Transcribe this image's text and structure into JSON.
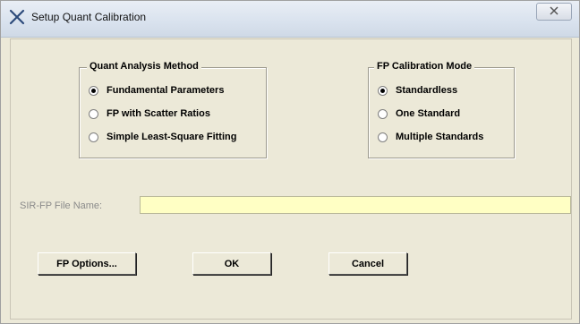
{
  "window": {
    "title": "Setup Quant Calibration"
  },
  "quant_method": {
    "title": "Quant Analysis Method",
    "options": [
      {
        "label": "Fundamental Parameters",
        "checked": true
      },
      {
        "label": "FP with Scatter Ratios",
        "checked": false
      },
      {
        "label": "Simple Least-Square Fitting",
        "checked": false
      }
    ]
  },
  "fp_mode": {
    "title": "FP Calibration Mode",
    "options": [
      {
        "label": "Standardless",
        "checked": true
      },
      {
        "label": "One Standard",
        "checked": false
      },
      {
        "label": "Multiple Standards",
        "checked": false
      }
    ]
  },
  "file": {
    "label": "SIR-FP File Name:",
    "value": ""
  },
  "buttons": {
    "fp_options": "FP Options...",
    "ok": "OK",
    "cancel": "Cancel"
  },
  "colors": {
    "input_bg": "#ffffc4",
    "dialog_bg": "#ece9d8"
  }
}
